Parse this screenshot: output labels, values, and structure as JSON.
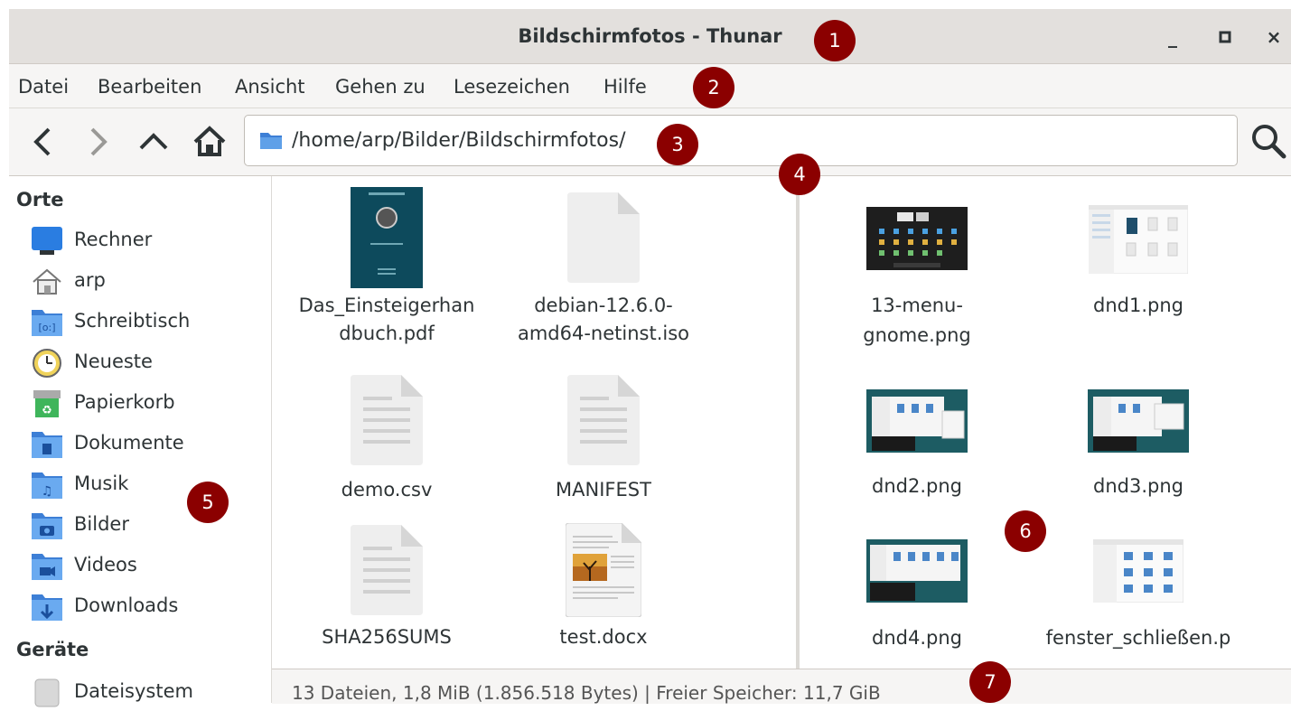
{
  "window": {
    "title": "Bildschirmfotos - Thunar",
    "minimize": "_",
    "maximize": "□",
    "close": "×"
  },
  "menu": [
    "Datei",
    "Bearbeiten",
    "Ansicht",
    "Gehen zu",
    "Lesezeichen",
    "Hilfe"
  ],
  "toolbar": {
    "back_icon": "chevron-left-icon",
    "forward_icon": "chevron-right-icon",
    "up_icon": "chevron-up-icon",
    "home_icon": "home-icon",
    "path": "/home/arp/Bilder/Bildschirmfotos/",
    "search_icon": "search-icon"
  },
  "sidebar": {
    "places_heading": "Orte",
    "places": [
      {
        "label": "Rechner",
        "icon": "computer-icon"
      },
      {
        "label": "arp",
        "icon": "home-folder-icon"
      },
      {
        "label": "Schreibtisch",
        "icon": "desktop-folder-icon"
      },
      {
        "label": "Neueste",
        "icon": "recent-clock-icon"
      },
      {
        "label": "Papierkorb",
        "icon": "trash-icon"
      },
      {
        "label": "Dokumente",
        "icon": "documents-folder-icon"
      },
      {
        "label": "Musik",
        "icon": "music-folder-icon"
      },
      {
        "label": "Bilder",
        "icon": "pictures-folder-icon"
      },
      {
        "label": "Videos",
        "icon": "videos-folder-icon"
      },
      {
        "label": "Downloads",
        "icon": "downloads-folder-icon"
      }
    ],
    "devices_heading": "Geräte",
    "devices": [
      {
        "label": "Dateisystem",
        "icon": "drive-icon"
      }
    ]
  },
  "left_pane": {
    "files": [
      {
        "name_line1": "Das_Einsteigerhan",
        "name_line2": "dbuch.pdf",
        "icon": "pdf-thumbnail"
      },
      {
        "name_line1": "debian-12.6.0-",
        "name_line2": "amd64-netinst.iso",
        "icon": "generic-file-icon"
      },
      {
        "name_line1": "demo.csv",
        "name_line2": "",
        "icon": "text-file-icon"
      },
      {
        "name_line1": "MANIFEST",
        "name_line2": "",
        "icon": "text-file-icon"
      },
      {
        "name_line1": "SHA256SUMS",
        "name_line2": "",
        "icon": "text-file-icon"
      },
      {
        "name_line1": "test.docx",
        "name_line2": "",
        "icon": "docx-thumbnail"
      }
    ]
  },
  "right_pane": {
    "files": [
      {
        "name_line1": "13-menu-",
        "name_line2": "gnome.png",
        "icon": "screenshot-thumbnail-dark"
      },
      {
        "name_line1": "dnd1.png",
        "name_line2": "",
        "icon": "screenshot-thumbnail-light"
      },
      {
        "name_line1": "dnd2.png",
        "name_line2": "",
        "icon": "screenshot-thumbnail-teal"
      },
      {
        "name_line1": "dnd3.png",
        "name_line2": "",
        "icon": "screenshot-thumbnail-teal"
      },
      {
        "name_line1": "dnd4.png",
        "name_line2": "",
        "icon": "screenshot-thumbnail-teal"
      },
      {
        "name_line1": "fenster_schließen.p",
        "name_line2": "",
        "icon": "screenshot-thumbnail-light"
      }
    ]
  },
  "status": "13 Dateien, 1,8 MiB (1.856.518 Bytes) | Freier Speicher: 11,7 GiB",
  "markers": [
    "1",
    "2",
    "3",
    "4",
    "5",
    "6",
    "7"
  ],
  "colors": {
    "marker": "#8b0000",
    "folder_blue": "#3d7fd6",
    "accent_dark": "#0d4a5c"
  }
}
